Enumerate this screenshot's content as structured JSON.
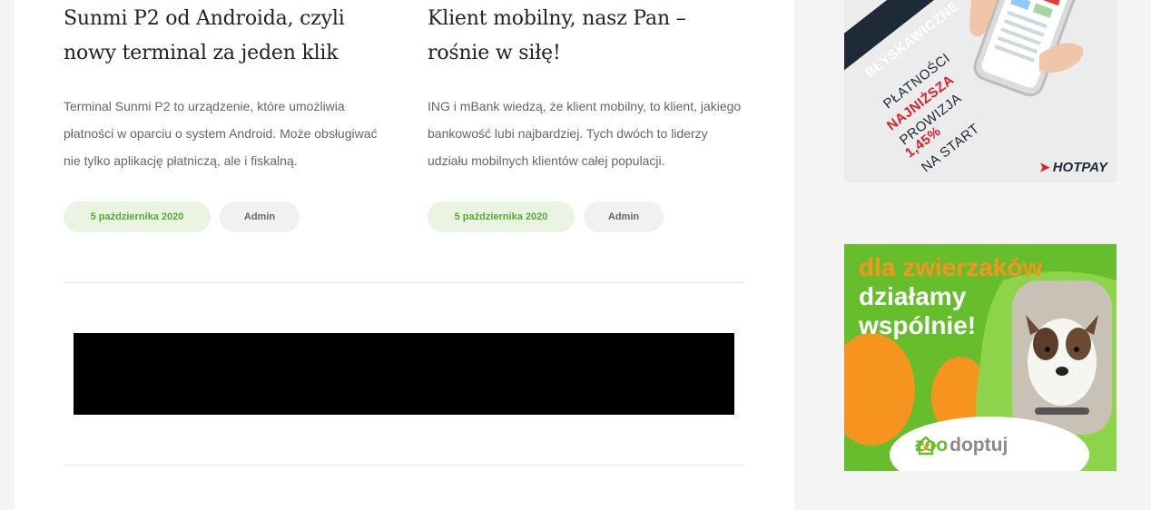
{
  "posts": [
    {
      "title": "Sunmi P2 od Androida, czyli nowy terminal za jeden klik",
      "excerpt": "Terminal Sunmi P2 to urządzenie, które umożliwia płatności w oparciu o system Android. Może obsługiwać nie tylko aplikację płatniczą, ale i fiskalną.",
      "date": "5 października 2020",
      "author": "Admin"
    },
    {
      "title": "Klient mobilny, nasz Pan – rośnie w siłę!",
      "excerpt": "ING i mBank wiedzą, że klient mobilny, to klient, jakiego bankowość lubi najbardziej. Tych dwóch to liderzy udziału mobilnych klientów całej populacji.",
      "date": "5 października 2020",
      "author": "Admin"
    }
  ],
  "ads": {
    "hotpay": {
      "line1": "BŁYSKAWICZNE",
      "line2": "PŁATNOŚCI",
      "line3": "NAJNIŻSZA",
      "line4": "PROWIZJA",
      "line5": "1,45%",
      "line6": "NA START",
      "logo": "HOTPAY",
      "colors": {
        "navy": "#1f2a38",
        "red": "#d6222a"
      }
    },
    "zoodoptuj": {
      "line1": "dla zwierzaków",
      "line2": "działamy",
      "line3": "wspólnie!",
      "brand_part1": "zoo",
      "brand_part2": "doptuj",
      "colors": {
        "green": "#66be2d",
        "orange": "#f7941d"
      }
    }
  },
  "icons": {
    "hotpay_logo": "arrow-logo-icon",
    "zoodoptuj_logo": "paw-house-icon"
  }
}
